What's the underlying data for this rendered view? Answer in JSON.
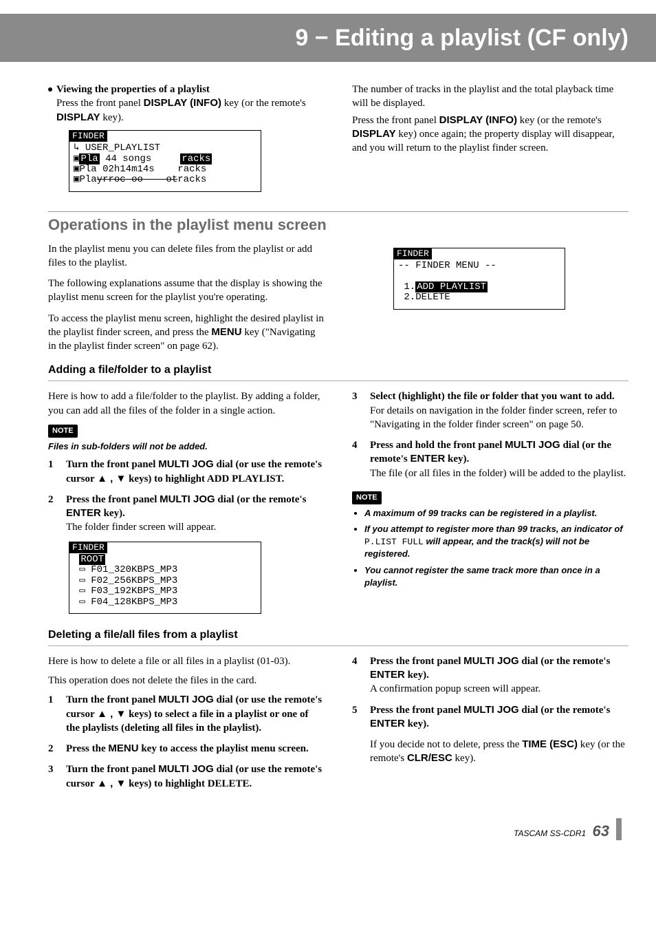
{
  "header": {
    "title": "9 − Editing a playlist (CF only)"
  },
  "intro": {
    "left": {
      "bullet_title": "Viewing the properties of a playlist",
      "line1_pre": "Press the front panel ",
      "key1": "DISPLAY (INFO)",
      "line1_mid": " key (or the remote's ",
      "key2": "DISPLAY",
      "line1_post": " key)."
    },
    "right": {
      "p1": "The number of tracks in the playlist and the total playback time will be displayed.",
      "p2_pre": "Press the front panel ",
      "p2_key1": "DISPLAY (INFO)",
      "p2_mid": " key (or the remote's ",
      "p2_key2": "DISPLAY",
      "p2_post": " key) once again; the property display will disappear, and you will return to the playlist finder screen."
    }
  },
  "fig1": {
    "header": "FINDER",
    "line_user": "↳ USER_PLAYLIST",
    "row1a": "Pla",
    "row1b_songs": "44 songs",
    "row1b_time": "02h14m14s",
    "row1c": "racks",
    "row2a": "Pla",
    "row2c": "racks",
    "row3a": "Pla",
    "row3c": "racks"
  },
  "section1": {
    "title": "Operations in the playlist menu screen",
    "p1": "In the playlist menu you can delete files from the playlist or add files to the playlist.",
    "p2": "The following explanations assume that the display is showing the playlist menu screen for the playlist you're operating.",
    "p3_pre": "To access the playlist menu screen, highlight the desired playlist in the playlist finder screen, and press the ",
    "p3_key": "MENU",
    "p3_post": " key (\"Navigating in the playlist finder screen\" on page 62)."
  },
  "fig2": {
    "header": "FINDER",
    "line_menu": "-- FINDER MENU --",
    "item1_num": "1.",
    "item1_label": "ADD PLAYLIST",
    "item2": "2.DELETE"
  },
  "sub_add": {
    "title": "Adding a file/folder to a playlist",
    "left_p": "Here is  how to add a file/folder to the playlist. By adding a folder, you can add all the files of the folder in a single action.",
    "note_label": "NOTE",
    "note_text": "Files in sub-folders will not be added.",
    "steps_left": {
      "s1_pre": "Turn the front panel ",
      "s1_key": "MULTI JOG",
      "s1_mid": " dial (or use the remote's cursor ",
      "s1_arrows": "▲ , ▼",
      "s1_post": " keys) to highlight ADD PLAYLIST.",
      "s2_pre": "Press the front panel ",
      "s2_key": "MULTI JOG",
      "s2_mid": " dial (or the remote's ",
      "s2_key2": "ENTER",
      "s2_post": " key).",
      "s2_desc": "The folder finder screen will appear."
    },
    "steps_right": {
      "s3_bold": "Select (highlight) the file or folder that you want to add.",
      "s3_desc": "For details on navigation in the folder finder screen, refer to \"Navigating in the folder finder screen\" on page 50.",
      "s4_pre": "Press and hold the front panel ",
      "s4_key": "MULTI JOG",
      "s4_mid": " dial (or the remote's ",
      "s4_key2": "ENTER",
      "s4_post": " key).",
      "s4_desc": "The file (or all files in the folder) will be added to the playlist."
    },
    "note2_label": "NOTE",
    "note2_items": {
      "a": "A maximum of 99 tracks can be registered in a playlist.",
      "b_pre": "If you attempt to register more than 99 tracks, an indicator of ",
      "b_code": "P.LIST FULL",
      "b_post": " will appear, and the track(s) will not be registered.",
      "c": "You cannot register the same track more than once in a playlist."
    }
  },
  "fig3": {
    "header": "FINDER",
    "root": "ROOT",
    "l1": "F01_320KBPS_MP3",
    "l2": "F02_256KBPS_MP3",
    "l3": "F03_192KBPS_MP3",
    "l4": "F04_128KBPS_MP3"
  },
  "sub_del": {
    "title": "Deleting a file/all files from a playlist",
    "p1": "Here is how to delete a file or all files in a playlist (01-03).",
    "p2": "This operation does not delete the files in the card.",
    "left_steps": {
      "s1_pre": "Turn the front panel ",
      "s1_key": "MULTI JOG",
      "s1_mid": " dial (or use the remote's cursor ",
      "s1_arrows": "▲ , ▼",
      "s1_post": " keys) to select a file in a playlist or one of the playlists (deleting all files in the playlist).",
      "s2_pre": "Press the ",
      "s2_key": "MENU",
      "s2_post": " key to access the playlist menu screen.",
      "s3_pre": "Turn the front panel ",
      "s3_key": "MULTI JOG",
      "s3_mid": " dial (or use the remote's cursor ",
      "s3_arrows": "▲ , ▼",
      "s3_post": " keys) to highlight DELETE."
    },
    "right_steps": {
      "s4_pre": "Press the front panel ",
      "s4_key": "MULTI JOG",
      "s4_mid": " dial (or the remote's ",
      "s4_key2": "ENTER",
      "s4_post": " key).",
      "s4_desc": "A confirmation popup screen will appear.",
      "s5_pre": " Press the front panel ",
      "s5_key": "MULTI JOG",
      "s5_mid": " dial (or the remote's ",
      "s5_key2": "ENTER",
      "s5_post": " key).",
      "s5_desc_pre": "If you decide not to delete, press the ",
      "s5_desc_k1": "TIME (ESC)",
      "s5_desc_mid": " key (or the remote's ",
      "s5_desc_k2": "CLR/ESC",
      "s5_desc_post": " key)."
    }
  },
  "footer": {
    "model": "TASCAM  SS-CDR1",
    "page": "63"
  }
}
